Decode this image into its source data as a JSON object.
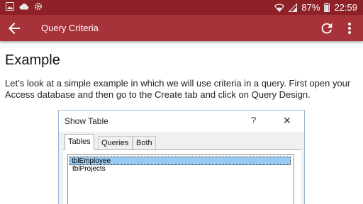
{
  "status_bar": {
    "notification_icons": [
      "image-icon",
      "cloud-icon",
      "settings-icon"
    ],
    "battery": "87%",
    "time": "22:59"
  },
  "app_bar": {
    "title": "Query Criteria",
    "color": "#a8323a"
  },
  "content": {
    "heading": "Example",
    "paragraph": "Let’s look at a simple example in which we will use criteria in a query. First open your Access database and then go to the Create tab and click on Query Design."
  },
  "dialog": {
    "title": "Show Table",
    "help": "?",
    "close": "✕",
    "tabs": [
      "Tables",
      "Queries",
      "Both"
    ],
    "items": [
      "tblEmployee",
      "tblProjects"
    ],
    "selected_color": "#99c9ef"
  }
}
